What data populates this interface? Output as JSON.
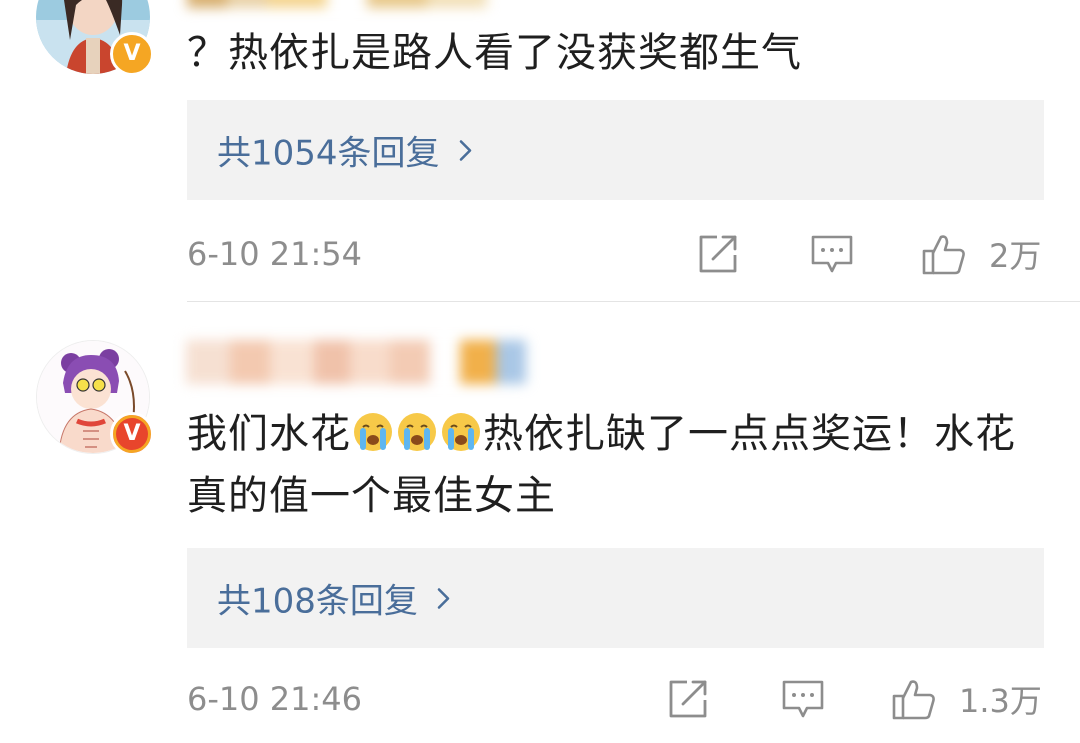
{
  "comments": [
    {
      "text": "？热依扎是路人看了没获奖都生气",
      "replies_label": "共1054条回复",
      "timestamp": "6-10 21:54",
      "likes": "2万"
    },
    {
      "text_part1": "我们水花",
      "text_part2": "热依扎缺了一点点奖运！水花真的值一个最佳女主",
      "emoji_name": "crying-face",
      "replies_label": "共108条回复",
      "timestamp": "6-10 21:46",
      "likes": "1.3万"
    }
  ],
  "icons": {
    "share": "share-icon",
    "comment": "comment-icon",
    "like": "thumbs-up-icon",
    "verified": "verified-badge",
    "chevron": "chevron-right-icon"
  },
  "colors": {
    "link": "#4a6e9a",
    "meta": "#8d8d8d",
    "text": "#1f1f1f",
    "reply_bg": "#f2f2f2",
    "badge": "#f5a623",
    "badge_red": "#e8452c"
  },
  "badge_letter": "V"
}
